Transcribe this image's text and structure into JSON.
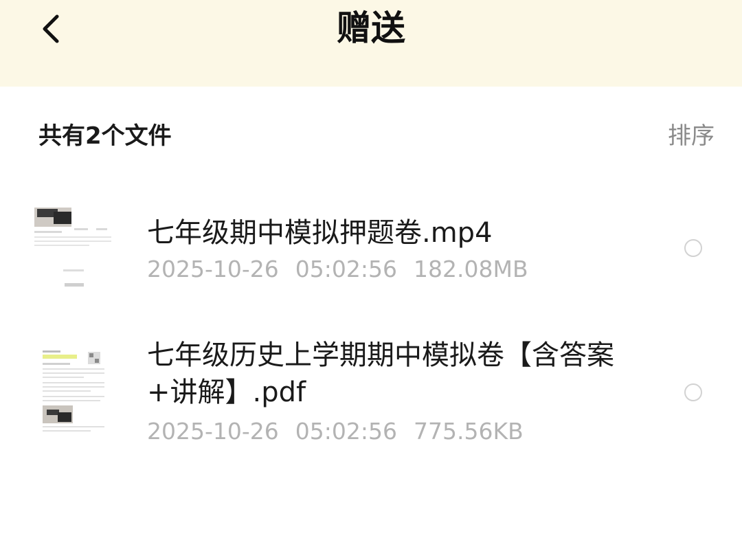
{
  "header": {
    "title": "赠送",
    "back_icon": "chevron-left-icon",
    "background": "#fcf8e6"
  },
  "summary": {
    "count_text": "共有2个文件",
    "sort_label": "排序"
  },
  "files": [
    {
      "name": "七年级期中模拟押题卷.mp4",
      "date": "2025-10-26",
      "time": "05:02:56",
      "size": "182.08MB",
      "thumb_icon": "video-thumbnail-icon",
      "selected": false
    },
    {
      "name": "七年级历史上学期期中模拟卷【含答案+讲解】.pdf",
      "date": "2025-10-26",
      "time": "05:02:56",
      "size": "775.56KB",
      "thumb_icon": "pdf-thumbnail-icon",
      "selected": false
    }
  ],
  "colors": {
    "meta_text": "#b3b3b3",
    "radio_border": "#d2d2d2",
    "sort_text": "#8a8a8a"
  }
}
